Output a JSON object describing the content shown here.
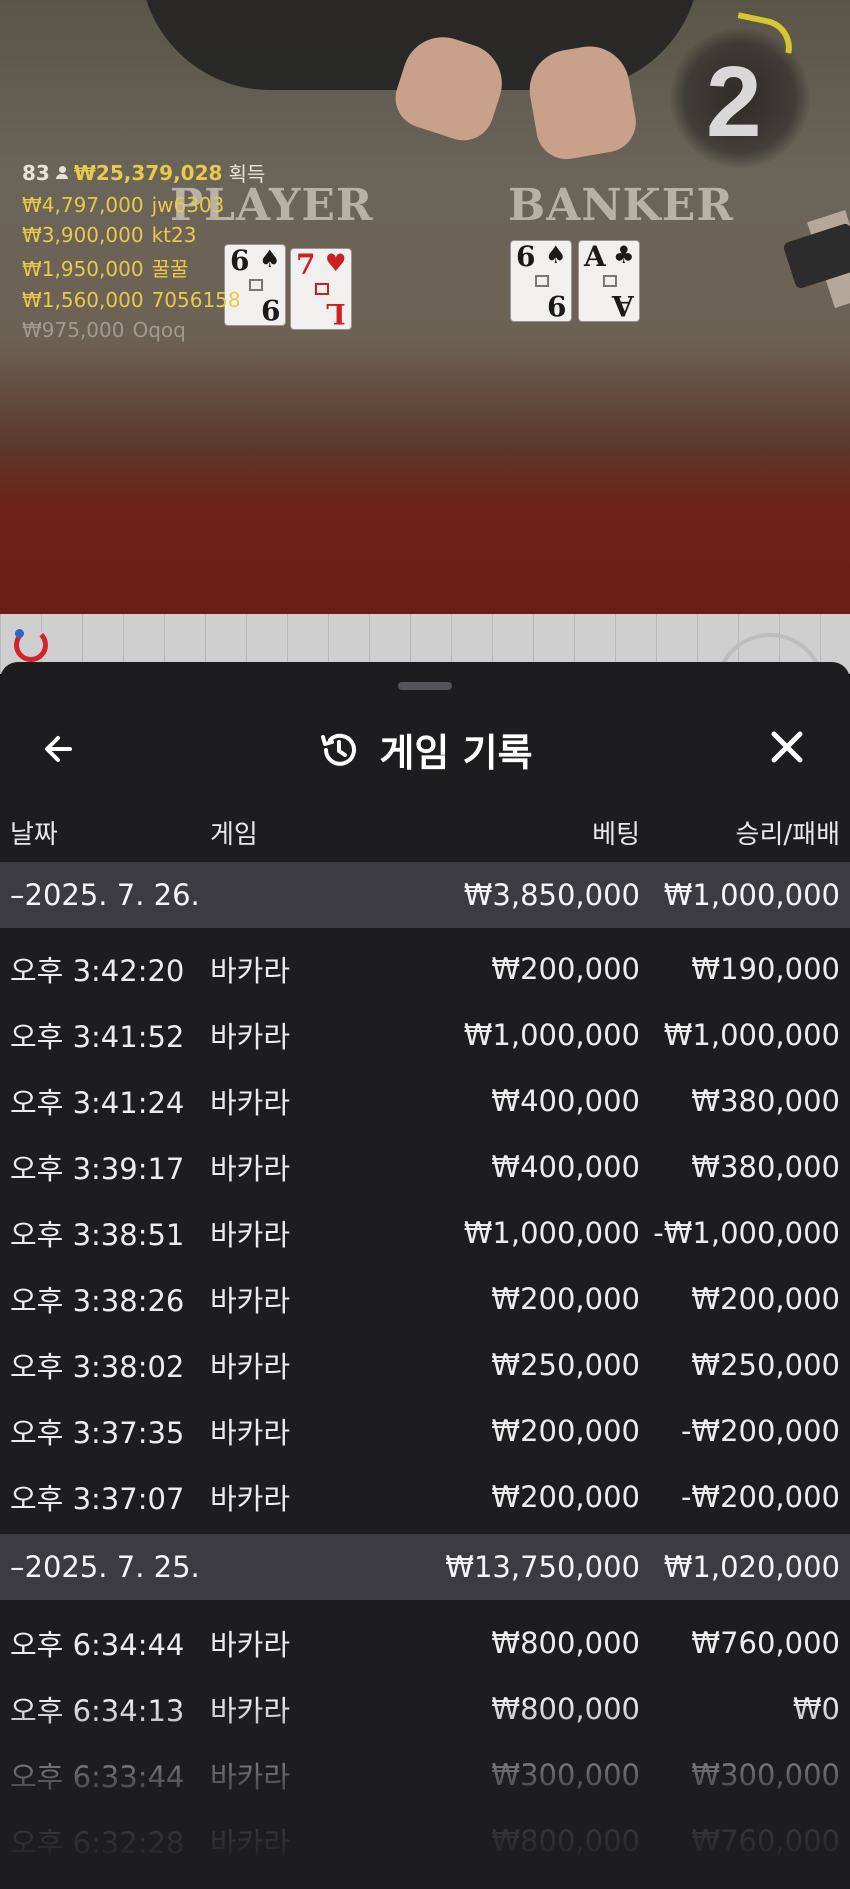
{
  "video": {
    "timer": "2",
    "table_labels": {
      "player": "PLAYER",
      "banker": "BANKER"
    },
    "player_cards": [
      {
        "rank": "6",
        "suit": "♠",
        "color": "black",
        "bottom": "9"
      },
      {
        "rank": "7",
        "suit": "♥",
        "color": "red",
        "bottom": "L"
      }
    ],
    "banker_cards": [
      {
        "rank": "6",
        "suit": "♠",
        "color": "black",
        "bottom": "9"
      },
      {
        "rank": "A",
        "suit": "♣",
        "color": "black",
        "bottom": "A"
      }
    ],
    "winners": {
      "count": "83",
      "amount": "₩25,379,028",
      "label": "획득"
    },
    "leaderboard": [
      {
        "amount": "₩4,797,000",
        "name": "jw6303"
      },
      {
        "amount": "₩3,900,000",
        "name": "kt23"
      },
      {
        "amount": "₩1,950,000",
        "name": "꿀꿀"
      },
      {
        "amount": "₩1,560,000",
        "name": "7056158"
      },
      {
        "amount": "₩975,000",
        "name": "Oqoq"
      }
    ]
  },
  "sheet": {
    "title": "게임 기록",
    "columns": {
      "date": "날짜",
      "game": "게임",
      "bet": "베팅",
      "result": "승리/패배"
    },
    "days": [
      {
        "date": "–2025. 7. 26.",
        "bet_total": "₩3,850,000",
        "result_total": "₩1,000,000",
        "rows": [
          {
            "time": "오후 3:42:20",
            "game": "바카라",
            "bet": "₩200,000",
            "result": "₩190,000"
          },
          {
            "time": "오후 3:41:52",
            "game": "바카라",
            "bet": "₩1,000,000",
            "result": "₩1,000,000"
          },
          {
            "time": "오후 3:41:24",
            "game": "바카라",
            "bet": "₩400,000",
            "result": "₩380,000"
          },
          {
            "time": "오후 3:39:17",
            "game": "바카라",
            "bet": "₩400,000",
            "result": "₩380,000"
          },
          {
            "time": "오후 3:38:51",
            "game": "바카라",
            "bet": "₩1,000,000",
            "result": "-₩1,000,000"
          },
          {
            "time": "오후 3:38:26",
            "game": "바카라",
            "bet": "₩200,000",
            "result": "₩200,000"
          },
          {
            "time": "오후 3:38:02",
            "game": "바카라",
            "bet": "₩250,000",
            "result": "₩250,000"
          },
          {
            "time": "오후 3:37:35",
            "game": "바카라",
            "bet": "₩200,000",
            "result": "-₩200,000"
          },
          {
            "time": "오후 3:37:07",
            "game": "바카라",
            "bet": "₩200,000",
            "result": "-₩200,000"
          }
        ]
      },
      {
        "date": "–2025. 7. 25.",
        "bet_total": "₩13,750,000",
        "result_total": "₩1,020,000",
        "rows": [
          {
            "time": "오후 6:34:44",
            "game": "바카라",
            "bet": "₩800,000",
            "result": "₩760,000"
          },
          {
            "time": "오후 6:34:13",
            "game": "바카라",
            "bet": "₩800,000",
            "result": "₩0"
          },
          {
            "time": "오후 6:33:44",
            "game": "바카라",
            "bet": "₩300,000",
            "result": "₩300,000"
          },
          {
            "time": "오후 6:32:28",
            "game": "바카라",
            "bet": "₩800,000",
            "result": "₩760,000"
          }
        ]
      }
    ]
  },
  "icons": {
    "back": "arrow-left-icon",
    "history": "history-icon",
    "close": "close-icon"
  },
  "colors": {
    "sheet_bg": "#1d1c1f",
    "day_row_bg": "#3c3b40",
    "gold": "#e8c94a",
    "felt_red": "#6c1d16"
  }
}
